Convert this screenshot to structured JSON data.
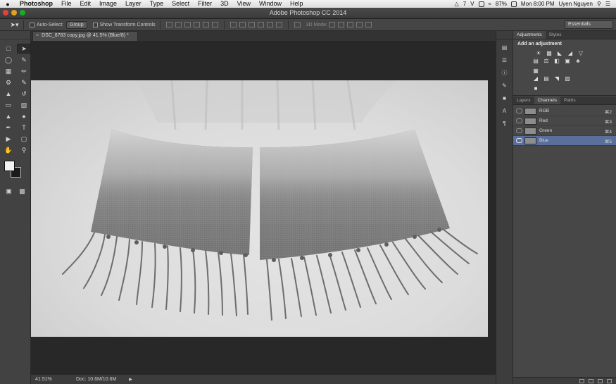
{
  "menubar": {
    "app": "Photoshop",
    "items": [
      "File",
      "Edit",
      "Image",
      "Layer",
      "Type",
      "Select",
      "Filter",
      "3D",
      "View",
      "Window",
      "Help"
    ],
    "battery": "87%",
    "clock": "Mon 8:00 PM",
    "user": "Uyen Nguyen",
    "status_num": "7",
    "status_letter": "V"
  },
  "window": {
    "title": "Adobe Photoshop CC 2014"
  },
  "options": {
    "auto_select_label": "Auto-Select:",
    "auto_select_value": "Group",
    "show_transform_label": "Show Transform Controls",
    "mode_label": "3D Mode:",
    "workspace": "Essentials"
  },
  "document": {
    "tab_title": "DSC_8783 copy.jpg @ 41.5% (Blue/8) *",
    "zoom": "41.51%",
    "doc_size": "Doc: 10.6M/10.6M"
  },
  "panels": {
    "adjust_tabs": [
      "Adjustments",
      "Styles"
    ],
    "add_adjustment": "Add an adjustment",
    "channel_tabs": [
      "Layers",
      "Channels",
      "Paths"
    ],
    "channels": [
      {
        "name": "RGB",
        "shortcut": "⌘2"
      },
      {
        "name": "Red",
        "shortcut": "⌘3"
      },
      {
        "name": "Green",
        "shortcut": "⌘4"
      },
      {
        "name": "Blue",
        "shortcut": "⌘5"
      }
    ]
  },
  "colors": {
    "accent": "#5a6f9a",
    "foreground": "#f2f2f2",
    "background": "#1a1a1a"
  }
}
